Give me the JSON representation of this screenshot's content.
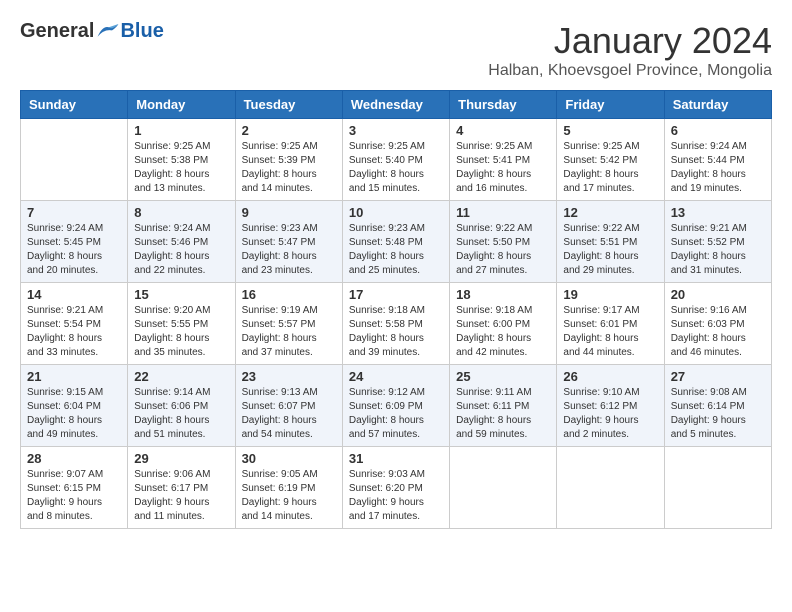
{
  "header": {
    "logo_general": "General",
    "logo_blue": "Blue",
    "month_title": "January 2024",
    "location": "Halban, Khoevsgoel Province, Mongolia"
  },
  "days_of_week": [
    "Sunday",
    "Monday",
    "Tuesday",
    "Wednesday",
    "Thursday",
    "Friday",
    "Saturday"
  ],
  "weeks": [
    [
      {
        "day": "",
        "info": ""
      },
      {
        "day": "1",
        "info": "Sunrise: 9:25 AM\nSunset: 5:38 PM\nDaylight: 8 hours\nand 13 minutes."
      },
      {
        "day": "2",
        "info": "Sunrise: 9:25 AM\nSunset: 5:39 PM\nDaylight: 8 hours\nand 14 minutes."
      },
      {
        "day": "3",
        "info": "Sunrise: 9:25 AM\nSunset: 5:40 PM\nDaylight: 8 hours\nand 15 minutes."
      },
      {
        "day": "4",
        "info": "Sunrise: 9:25 AM\nSunset: 5:41 PM\nDaylight: 8 hours\nand 16 minutes."
      },
      {
        "day": "5",
        "info": "Sunrise: 9:25 AM\nSunset: 5:42 PM\nDaylight: 8 hours\nand 17 minutes."
      },
      {
        "day": "6",
        "info": "Sunrise: 9:24 AM\nSunset: 5:44 PM\nDaylight: 8 hours\nand 19 minutes."
      }
    ],
    [
      {
        "day": "7",
        "info": "Sunrise: 9:24 AM\nSunset: 5:45 PM\nDaylight: 8 hours\nand 20 minutes."
      },
      {
        "day": "8",
        "info": "Sunrise: 9:24 AM\nSunset: 5:46 PM\nDaylight: 8 hours\nand 22 minutes."
      },
      {
        "day": "9",
        "info": "Sunrise: 9:23 AM\nSunset: 5:47 PM\nDaylight: 8 hours\nand 23 minutes."
      },
      {
        "day": "10",
        "info": "Sunrise: 9:23 AM\nSunset: 5:48 PM\nDaylight: 8 hours\nand 25 minutes."
      },
      {
        "day": "11",
        "info": "Sunrise: 9:22 AM\nSunset: 5:50 PM\nDaylight: 8 hours\nand 27 minutes."
      },
      {
        "day": "12",
        "info": "Sunrise: 9:22 AM\nSunset: 5:51 PM\nDaylight: 8 hours\nand 29 minutes."
      },
      {
        "day": "13",
        "info": "Sunrise: 9:21 AM\nSunset: 5:52 PM\nDaylight: 8 hours\nand 31 minutes."
      }
    ],
    [
      {
        "day": "14",
        "info": "Sunrise: 9:21 AM\nSunset: 5:54 PM\nDaylight: 8 hours\nand 33 minutes."
      },
      {
        "day": "15",
        "info": "Sunrise: 9:20 AM\nSunset: 5:55 PM\nDaylight: 8 hours\nand 35 minutes."
      },
      {
        "day": "16",
        "info": "Sunrise: 9:19 AM\nSunset: 5:57 PM\nDaylight: 8 hours\nand 37 minutes."
      },
      {
        "day": "17",
        "info": "Sunrise: 9:18 AM\nSunset: 5:58 PM\nDaylight: 8 hours\nand 39 minutes."
      },
      {
        "day": "18",
        "info": "Sunrise: 9:18 AM\nSunset: 6:00 PM\nDaylight: 8 hours\nand 42 minutes."
      },
      {
        "day": "19",
        "info": "Sunrise: 9:17 AM\nSunset: 6:01 PM\nDaylight: 8 hours\nand 44 minutes."
      },
      {
        "day": "20",
        "info": "Sunrise: 9:16 AM\nSunset: 6:03 PM\nDaylight: 8 hours\nand 46 minutes."
      }
    ],
    [
      {
        "day": "21",
        "info": "Sunrise: 9:15 AM\nSunset: 6:04 PM\nDaylight: 8 hours\nand 49 minutes."
      },
      {
        "day": "22",
        "info": "Sunrise: 9:14 AM\nSunset: 6:06 PM\nDaylight: 8 hours\nand 51 minutes."
      },
      {
        "day": "23",
        "info": "Sunrise: 9:13 AM\nSunset: 6:07 PM\nDaylight: 8 hours\nand 54 minutes."
      },
      {
        "day": "24",
        "info": "Sunrise: 9:12 AM\nSunset: 6:09 PM\nDaylight: 8 hours\nand 57 minutes."
      },
      {
        "day": "25",
        "info": "Sunrise: 9:11 AM\nSunset: 6:11 PM\nDaylight: 8 hours\nand 59 minutes."
      },
      {
        "day": "26",
        "info": "Sunrise: 9:10 AM\nSunset: 6:12 PM\nDaylight: 9 hours\nand 2 minutes."
      },
      {
        "day": "27",
        "info": "Sunrise: 9:08 AM\nSunset: 6:14 PM\nDaylight: 9 hours\nand 5 minutes."
      }
    ],
    [
      {
        "day": "28",
        "info": "Sunrise: 9:07 AM\nSunset: 6:15 PM\nDaylight: 9 hours\nand 8 minutes."
      },
      {
        "day": "29",
        "info": "Sunrise: 9:06 AM\nSunset: 6:17 PM\nDaylight: 9 hours\nand 11 minutes."
      },
      {
        "day": "30",
        "info": "Sunrise: 9:05 AM\nSunset: 6:19 PM\nDaylight: 9 hours\nand 14 minutes."
      },
      {
        "day": "31",
        "info": "Sunrise: 9:03 AM\nSunset: 6:20 PM\nDaylight: 9 hours\nand 17 minutes."
      },
      {
        "day": "",
        "info": ""
      },
      {
        "day": "",
        "info": ""
      },
      {
        "day": "",
        "info": ""
      }
    ]
  ]
}
